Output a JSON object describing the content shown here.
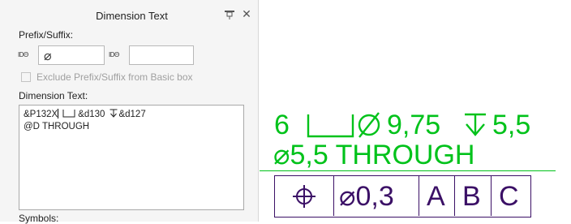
{
  "dialog": {
    "title": "Dimension Text",
    "prefix_suffix_label": "Prefix/Suffix:",
    "prefix_field_icon": "IDΘ",
    "prefix_value": "⌀",
    "suffix_field_icon": "IDΘ",
    "suffix_value": "",
    "exclude_checkbox_label": "Exclude Prefix/Suffix from Basic box",
    "exclude_checked": false,
    "dimension_text_label": "Dimension Text:",
    "dimension_text_line1_a": "&P132X",
    "dimension_text_line1_b": "&d130",
    "dimension_text_line1_c": "&d127",
    "dimension_text_line2": "@D THROUGH",
    "symbols_label": "Symbols:"
  },
  "drawing": {
    "dimension": {
      "count": "6",
      "diameter_value": "9,75",
      "depth_value": "5,5",
      "through_text": "⌀5,5 THROUGH",
      "color": "#00c21a"
    },
    "feature_control_frame": {
      "tolerance": "⌀0,3",
      "datums": [
        "A",
        "B",
        "C"
      ],
      "color": "#3b1066"
    },
    "leader_color": "#00c21a"
  }
}
